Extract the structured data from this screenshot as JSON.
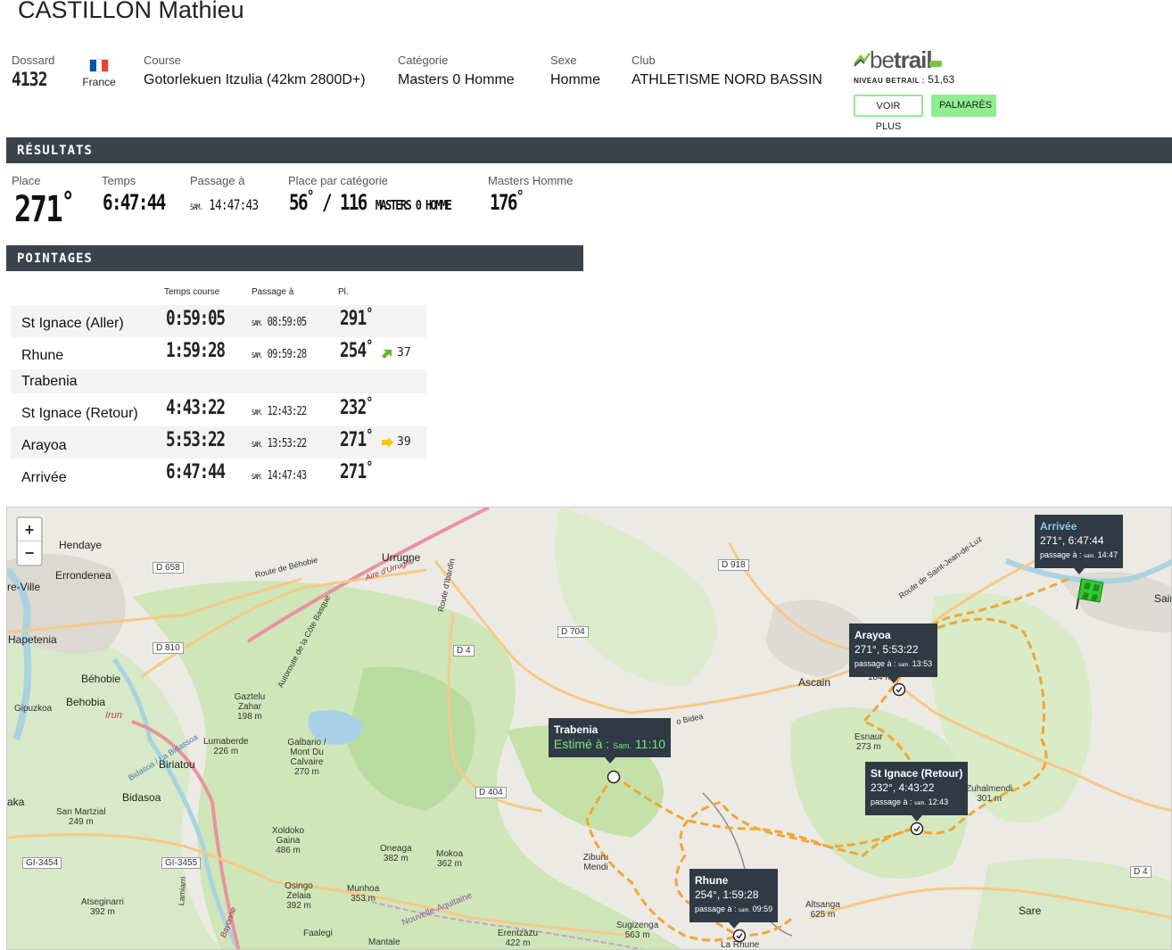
{
  "runner": {
    "name": "CASTILLON Mathieu"
  },
  "info": {
    "bib_label": "Dossard",
    "bib": "4132",
    "country": "France",
    "flag_colors": [
      "#0055a4",
      "#ffffff",
      "#ef4135"
    ],
    "course_label": "Course",
    "course": "Gotorlekuen Itzulia (42km 2800D+)",
    "category_label": "Catégorie",
    "category": "Masters 0 Homme",
    "sex_label": "Sexe",
    "sex": "Homme",
    "club_label": "Club",
    "club": "ATHLETISME NORD BASSIN"
  },
  "betrail": {
    "logo_be": "be",
    "logo_trail": "trail",
    "level_label": "NIVEAU BETRAIL :",
    "level": "51,63",
    "voir_plus": "VOIR PLUS",
    "palmares": "PALMARÈS"
  },
  "results": {
    "section": "RÉSULTATS",
    "place_label": "Place",
    "place": "271",
    "time_label": "Temps",
    "time": "6:47:44",
    "passage_label": "Passage à",
    "passage_day": "SAM.",
    "passage_time": "14:47:43",
    "cat_label": "Place par catégorie",
    "cat_place": "56",
    "cat_total": "116",
    "cat_name": "MASTERS 0 HOMME",
    "masters_label": "Masters Homme",
    "masters_place": "176"
  },
  "pointages": {
    "section": "POINTAGES",
    "col_time": "Temps course",
    "col_passage": "Passage à",
    "col_place": "Pl.",
    "day": "SAM.",
    "rows": [
      {
        "name": "St Ignace (Aller)",
        "time": "0:59:05",
        "passage": "08:59:05",
        "place": "291",
        "trend": ""
      },
      {
        "name": "Rhune",
        "time": "1:59:28",
        "passage": "09:59:28",
        "place": "254",
        "trend": "37"
      },
      {
        "name": "Trabenia",
        "time": "",
        "passage": "",
        "place": "",
        "trend": ""
      },
      {
        "name": "St Ignace (Retour)",
        "time": "4:43:22",
        "passage": "12:43:22",
        "place": "232",
        "trend": ""
      },
      {
        "name": "Arayoa",
        "time": "5:53:22",
        "passage": "13:53:22",
        "place": "271",
        "trend": "39"
      },
      {
        "name": "Arrivée",
        "time": "6:47:44",
        "passage": "14:47:43",
        "place": "271",
        "trend": ""
      }
    ]
  },
  "map": {
    "zoom_in": "+",
    "zoom_out": "−",
    "tips": {
      "arrivee": {
        "title": "Arrivée",
        "line": "271°, 6:47:44",
        "passage_label": "passage à :",
        "day": "sam.",
        "time": "14:47"
      },
      "arayoa": {
        "title": "Arayoa",
        "line": "271°, 5:53:22",
        "passage_label": "passage à :",
        "day": "sam.",
        "time": "13:53"
      },
      "trabenia": {
        "title": "Trabenia",
        "est_label": "Estimé à :",
        "day": "Sam.",
        "time": "11:10"
      },
      "stignace": {
        "title": "St Ignace (Retour)",
        "line": "232°, 4:43:22",
        "passage_label": "passage à :",
        "day": "sam.",
        "time": "12:43"
      },
      "rhune": {
        "title": "Rhune",
        "line": "254°, 1:59:28",
        "passage_label": "passage à :",
        "day": "sam.",
        "time": "09:59"
      }
    },
    "labels": {
      "hendaye": "Hendaye",
      "errondenea": "Errondenea",
      "reville": "re-Ville",
      "hapetenia": "Hapetenia",
      "behobie": "Béhobie",
      "behobia": "Behobia",
      "gipuzkoa": "Gipuzkoa",
      "irun": "Irun",
      "biriatou": "Biriatou",
      "bidasoa": "Bidasoa",
      "aka": "aka",
      "urrugne": "Urrugne",
      "ascain": "Ascain",
      "sare": "Sare",
      "gaztelu": "Gaztelu Zahar",
      "gaztelu_alt": "198 m",
      "lumaberde": "Lumaberde",
      "lumaberde_alt": "226 m",
      "galbario": "Galbario / Mont Du Calvaire",
      "galbario_alt": "270 m",
      "sanmartzial": "San Martzial",
      "sanmartzial_alt": "249 m",
      "xoldoko": "Xoldoko Gaina",
      "xoldoko_alt": "486 m",
      "oneaga": "Oneaga",
      "oneaga_alt": "382 m",
      "mokoa": "Mokoa",
      "mokoa_alt": "362 m",
      "osingo": "Osingo Zelaia",
      "osingo_alt": "392 m",
      "munhoa": "Munhoa",
      "munhoa_alt": "353 m",
      "atseginarri": "Atseginarri",
      "atseginarri_alt": "392 m",
      "faalegi": "Faalegi",
      "ziburu": "Ziburu Mendi",
      "esnaur": "Esnaur",
      "esnaur_alt": "273 m",
      "zuhalmendi": "Zuhalmendi",
      "zuhalmendi_alt": "301 m",
      "altsanga": "Altsanga",
      "altsanga_alt": "625 m",
      "sugizenga": "Sugizenga",
      "sugizenga_alt": "563 m",
      "erentzazu": "Erentzazu",
      "erentzazu_alt": "422 m",
      "larhune": "La Rhune",
      "mantale": "Mantale",
      "nouvelle": "Nouvelle-Aquitaine",
      "saint": "Saint-",
      "alt184": "184 m",
      "route_behobie": "Route de Béhobie",
      "aire_urrugne": "Aire d'Urrugne",
      "route_ibardin": "Route d'Ibardin",
      "route_sjl": "Route de Saint-Jean-de-Luz",
      "autoroute": "Autoroute de la Côte Basque",
      "bidea": "o Bidea",
      "bidasoa_river": "Bidasoa / La Bidassoa",
      "lamiarri": "Lamiarri",
      "bayonne": "Bayonne"
    },
    "roads": {
      "d658": "D 658",
      "d810": "D 810",
      "d918": "D 918",
      "d704": "D 704",
      "d4a": "D 4",
      "d404": "D 404",
      "gi3454": "GI-3454",
      "gi3455": "GI-3455",
      "d4b": "D 4"
    }
  }
}
